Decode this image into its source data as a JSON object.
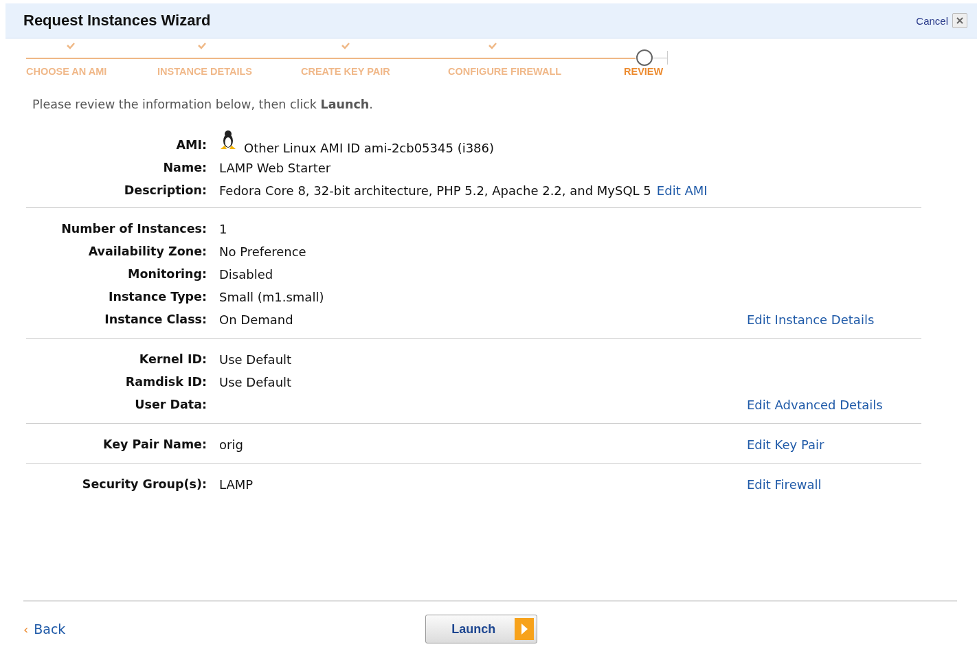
{
  "window": {
    "title": "Request Instances Wizard",
    "cancel": "Cancel"
  },
  "steps": [
    {
      "label": "CHOOSE AN AMI",
      "done": true,
      "selected": false
    },
    {
      "label": "INSTANCE DETAILS",
      "done": true,
      "selected": false
    },
    {
      "label": "CREATE KEY PAIR",
      "done": true,
      "selected": false
    },
    {
      "label": "CONFIGURE FIREWALL",
      "done": true,
      "selected": false
    },
    {
      "label": "REVIEW",
      "done": false,
      "selected": true
    }
  ],
  "intro": "Please review the information below, then click **Launch**.",
  "sections": [
    {
      "rows": [
        {
          "label": "AMI:",
          "value": "Other Linux AMI ID ami-2cb05345 (i386)",
          "kind": "ami"
        },
        {
          "label": "Name:",
          "value": "LAMP Web Starter",
          "kind": "text"
        },
        {
          "label": "Description:",
          "value": "Fedora Core 8, 32-bit architecture, PHP 5.2, Apache 2.2, and MySQL 5",
          "kind": "text",
          "link": "Edit AMI"
        }
      ]
    },
    {
      "rows": [
        {
          "label": "Number of Instances:",
          "value": "1",
          "kind": "text"
        },
        {
          "label": "Availability Zone:",
          "value": "No Preference",
          "kind": "text"
        },
        {
          "label": "Monitoring:",
          "value": "Disabled",
          "kind": "text"
        },
        {
          "label": "Instance Type:",
          "value": "Small (m1.small)",
          "kind": "text"
        },
        {
          "label": "Instance Class:",
          "value": "On Demand",
          "kind": "text"
        }
      ],
      "edit": "Edit Instance Details"
    },
    {
      "rows": [
        {
          "label": "Kernel ID:",
          "value": "Use Default",
          "kind": "text"
        },
        {
          "label": "Ramdisk ID:",
          "value": "Use Default",
          "kind": "text"
        },
        {
          "label": "User Data:",
          "kind": "text"
        }
      ],
      "edit": "Edit Advanced Details"
    },
    {
      "rows": [
        {
          "label": "Key Pair Name:",
          "value": "orig",
          "kind": "text"
        }
      ],
      "edit": "Edit Key Pair"
    },
    {
      "rows": [
        {
          "label": "Security Group(s):",
          "value": "LAMP",
          "kind": "text"
        }
      ],
      "edit": "Edit Firewall"
    }
  ],
  "footer": {
    "back_caret": "‹",
    "back": "Back",
    "launch": "Launch"
  }
}
